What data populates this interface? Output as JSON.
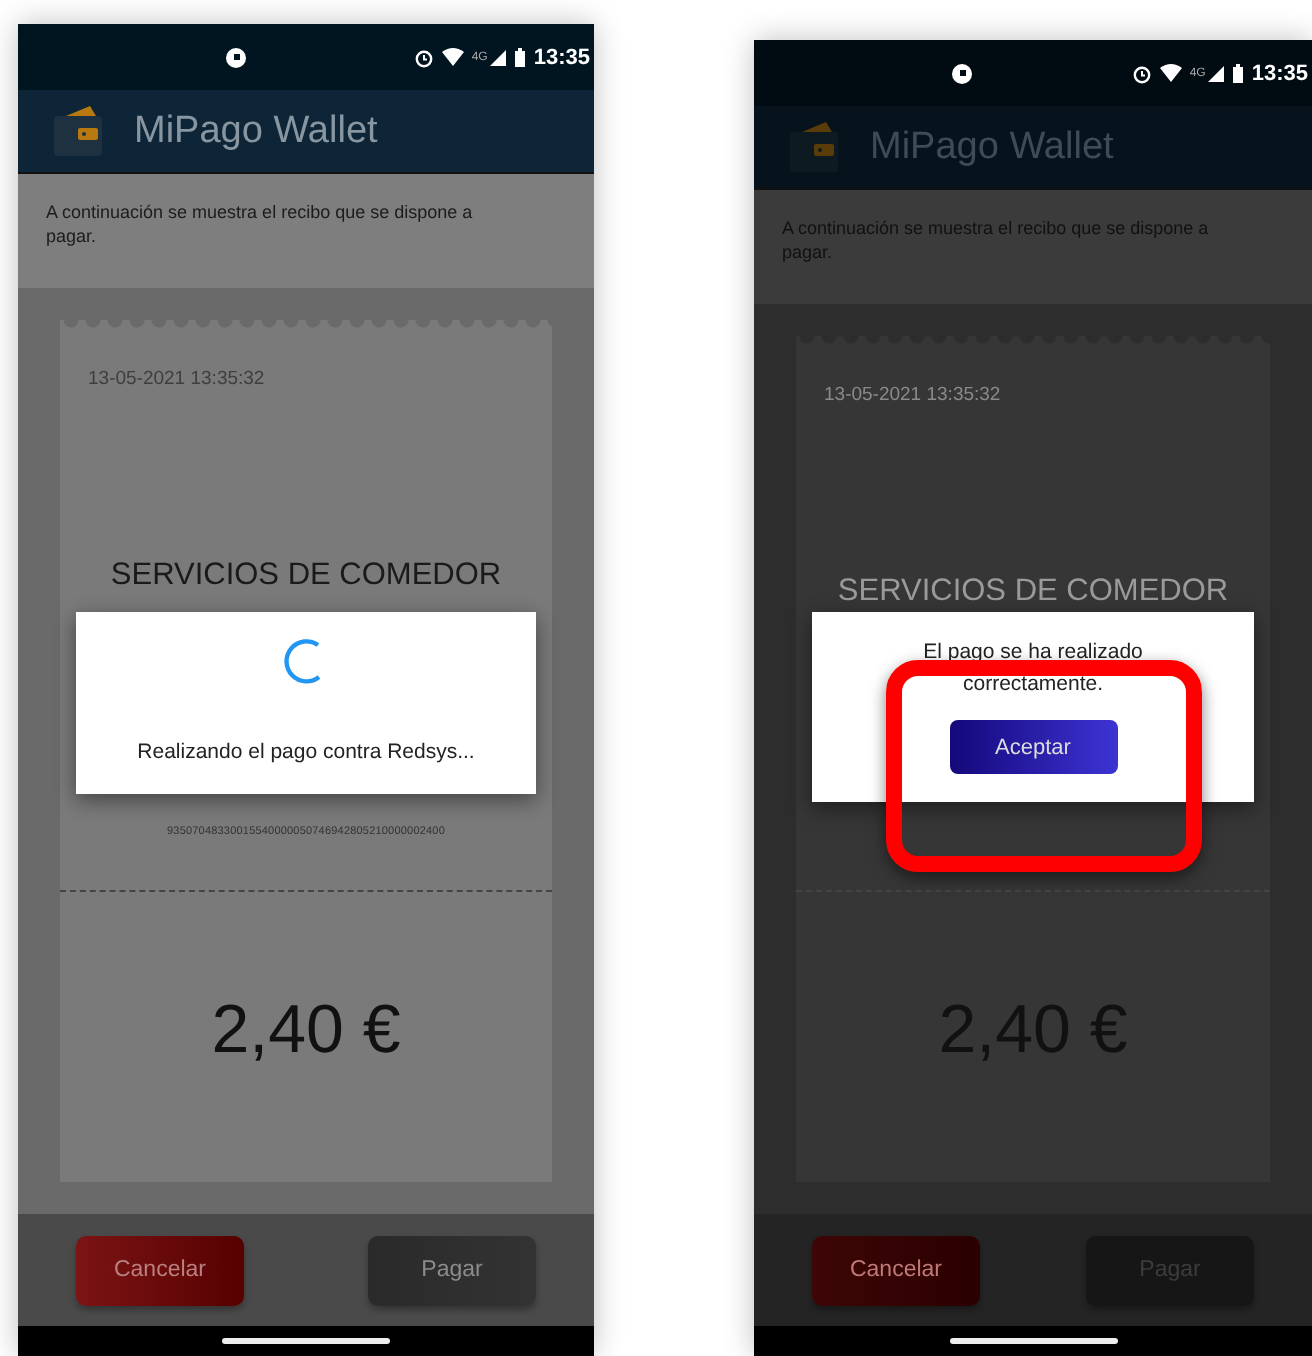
{
  "phones": [
    {
      "status_bar": {
        "network": "4G",
        "time": "13:35"
      },
      "app_bar": {
        "title": "MiPago Wallet"
      },
      "intro": "A continuación se muestra el recibo que se dispone a pagar.",
      "receipt": {
        "date": "13-05-2021 13:35:32",
        "title_lines": [
          "SERVICIOS DE COMEDOR"
        ],
        "reference": "93507048330015540000050746942805210000002400",
        "amount": "2,40 €"
      },
      "buttons": [
        {
          "kind": "cancel",
          "label": "Cancelar"
        },
        {
          "kind": "pay",
          "label": "Pagar"
        }
      ],
      "dialog": {
        "kind": "progress",
        "message": "Realizando el pago contra Redsys..."
      }
    },
    {
      "status_bar": {
        "network": "4G",
        "time": "13:35"
      },
      "app_bar": {
        "title": "MiPago Wallet"
      },
      "intro": "A continuación se muestra el recibo que se dispone a pagar.",
      "receipt": {
        "date": "13-05-2021 13:35:32",
        "title_lines": [
          "SERVICIOS DE COMEDOR"
        ],
        "amount": "2,40 €"
      },
      "buttons": [
        {
          "kind": "cancel",
          "label": "Cancelar"
        },
        {
          "kind": "pay",
          "label": "Pagar"
        }
      ],
      "dialog": {
        "kind": "message",
        "message": "El pago se ha realizado correctamente.",
        "button": "Aceptar",
        "highlighted": true
      }
    }
  ]
}
